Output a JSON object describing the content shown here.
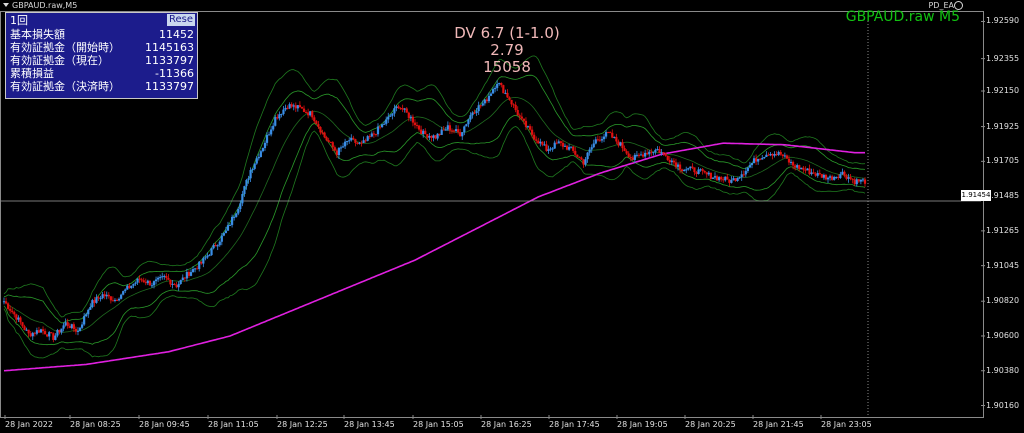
{
  "window": {
    "title": "GBPAUD.raw,M5",
    "symbol_label": "GBPAUD.raw M5",
    "ea_name": "PD_EA"
  },
  "info_panel": {
    "header": "1回",
    "reset_label": "Rese",
    "rows": [
      {
        "label": "基本損失額",
        "value": "11452"
      },
      {
        "label": "有効証拠金（開始時）",
        "value": "1145163"
      },
      {
        "label": "有効証拠金（現在）",
        "value": "1133797"
      },
      {
        "label": "累積損益",
        "value": "-11366"
      },
      {
        "label": "有効証拠金（決済時）",
        "value": "1133797"
      }
    ]
  },
  "annotation": {
    "line1": "DV 6.7 (1-1.0)",
    "line2": "2.79",
    "line3": "15058"
  },
  "colors": {
    "background": "#000000",
    "bull_candle": "#3a8ee6",
    "bear_candle": "#e01010",
    "bollinger": "#1f7a1f",
    "ma_line": "#e020e0",
    "price_line": "#a0a0a0",
    "symbol_text": "#12c212",
    "panel_bg": "#1c1c8c"
  },
  "chart_data": {
    "type": "candlestick",
    "symbol": "GBPAUD.raw",
    "timeframe": "M5",
    "ylim": [
      1.901,
      1.9265
    ],
    "current_price": "1.91454",
    "current_price_value": 1.91454,
    "y_ticks": [
      "1.92590",
      "1.92355",
      "1.92150",
      "1.91925",
      "1.91705",
      "1.91485",
      "1.91265",
      "1.91045",
      "1.90820",
      "1.90600",
      "1.90380",
      "1.90160"
    ],
    "y_tick_values": [
      1.9259,
      1.92355,
      1.9215,
      1.91925,
      1.91705,
      1.91485,
      1.91265,
      1.91045,
      1.9082,
      1.906,
      1.9038,
      1.9016
    ],
    "x_ticks": [
      "28 Jan 2022",
      "28 Jan 08:25",
      "28 Jan 09:45",
      "28 Jan 11:05",
      "28 Jan 12:25",
      "28 Jan 13:45",
      "28 Jan 15:05",
      "28 Jan 16:25",
      "28 Jan 17:45",
      "28 Jan 19:05",
      "28 Jan 20:25",
      "28 Jan 21:45",
      "28 Jan 23:05"
    ],
    "price_path": [
      [
        0,
        1.9082
      ],
      [
        6,
        1.9072
      ],
      [
        12,
        1.9061
      ],
      [
        18,
        1.9064
      ],
      [
        24,
        1.9059
      ],
      [
        30,
        1.9068
      ],
      [
        36,
        1.9063
      ],
      [
        42,
        1.908
      ],
      [
        48,
        1.9086
      ],
      [
        54,
        1.9083
      ],
      [
        60,
        1.909
      ],
      [
        66,
        1.9096
      ],
      [
        72,
        1.9093
      ],
      [
        78,
        1.9097
      ],
      [
        84,
        1.9092
      ],
      [
        90,
        1.91
      ],
      [
        96,
        1.9106
      ],
      [
        102,
        1.9116
      ],
      [
        108,
        1.9126
      ],
      [
        114,
        1.9142
      ],
      [
        120,
        1.9165
      ],
      [
        126,
        1.918
      ],
      [
        132,
        1.9198
      ],
      [
        138,
        1.9206
      ],
      [
        144,
        1.9204
      ],
      [
        150,
        1.92
      ],
      [
        156,
        1.9186
      ],
      [
        162,
        1.9176
      ],
      [
        168,
        1.9184
      ],
      [
        174,
        1.9181
      ],
      [
        180,
        1.9188
      ],
      [
        186,
        1.9196
      ],
      [
        192,
        1.9206
      ],
      [
        198,
        1.9198
      ],
      [
        204,
        1.9188
      ],
      [
        210,
        1.9186
      ],
      [
        216,
        1.9192
      ],
      [
        222,
        1.9188
      ],
      [
        228,
        1.9202
      ],
      [
        234,
        1.9208
      ],
      [
        240,
        1.9221
      ],
      [
        246,
        1.921
      ],
      [
        252,
        1.9196
      ],
      [
        258,
        1.9186
      ],
      [
        264,
        1.9178
      ],
      [
        270,
        1.9182
      ],
      [
        276,
        1.9178
      ],
      [
        282,
        1.917
      ],
      [
        288,
        1.9184
      ],
      [
        294,
        1.9188
      ],
      [
        300,
        1.9181
      ],
      [
        306,
        1.9172
      ],
      [
        312,
        1.9176
      ],
      [
        318,
        1.9178
      ],
      [
        324,
        1.9172
      ],
      [
        330,
        1.9166
      ],
      [
        336,
        1.9165
      ],
      [
        342,
        1.9162
      ],
      [
        348,
        1.916
      ],
      [
        354,
        1.9158
      ],
      [
        360,
        1.9164
      ],
      [
        366,
        1.9172
      ],
      [
        372,
        1.9176
      ],
      [
        378,
        1.9175
      ],
      [
        384,
        1.9168
      ],
      [
        390,
        1.9165
      ],
      [
        396,
        1.9162
      ],
      [
        402,
        1.916
      ],
      [
        408,
        1.9163
      ],
      [
        414,
        1.9158
      ]
    ],
    "ma_path": [
      [
        0,
        1.9038
      ],
      [
        40,
        1.9042
      ],
      [
        80,
        1.905
      ],
      [
        110,
        1.906
      ],
      [
        140,
        1.9076
      ],
      [
        170,
        1.9092
      ],
      [
        200,
        1.9108
      ],
      [
        230,
        1.9128
      ],
      [
        260,
        1.9148
      ],
      [
        290,
        1.9163
      ],
      [
        320,
        1.9175
      ],
      [
        350,
        1.9182
      ],
      [
        380,
        1.9181
      ],
      [
        414,
        1.9176
      ]
    ]
  }
}
